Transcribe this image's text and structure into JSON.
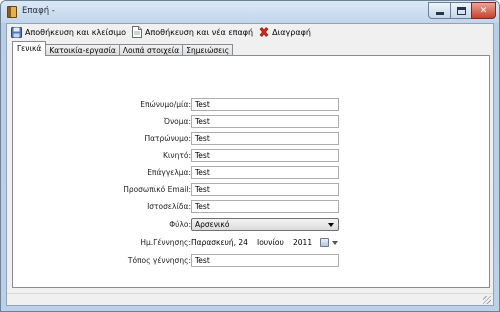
{
  "window": {
    "title": "Επαφή -"
  },
  "toolbar": {
    "save_close_label": "Αποθήκευση και κλείσιμο",
    "save_new_label": "Αποθήκευση και νέα επαφή",
    "delete_label": "Διαγραφή"
  },
  "tabs": [
    {
      "label": "Γενικά",
      "active": true
    },
    {
      "label": "Κατοικία-εργασία",
      "active": false
    },
    {
      "label": "Λοιπά στοιχεία",
      "active": false
    },
    {
      "label": "Σημειώσεις",
      "active": false
    }
  ],
  "form": {
    "surname": {
      "label": "Επώνυμο/μία:",
      "value": "Test"
    },
    "first_name": {
      "label": "Όνομα:",
      "value": "Test"
    },
    "fathers_name": {
      "label": "Πατρώνυμο:",
      "value": "Test"
    },
    "mobile": {
      "label": "Κινητό:",
      "value": "Test"
    },
    "profession": {
      "label": "Επάγγελμα:",
      "value": "Test"
    },
    "personal_email": {
      "label": "Προσωπικό Email:",
      "value": "Test"
    },
    "website": {
      "label": "Ιστοσελίδα:",
      "value": "Test"
    },
    "gender": {
      "label": "Φύλο:",
      "value": "Αρσενικό"
    },
    "birth_date": {
      "label": "Ημ.Γέννησης:",
      "day": "Παρασκευή, 24",
      "month": "Ιουνίου",
      "year": "2011"
    },
    "birth_place": {
      "label": "Τόπος γέννησης:",
      "value": "Test"
    }
  }
}
